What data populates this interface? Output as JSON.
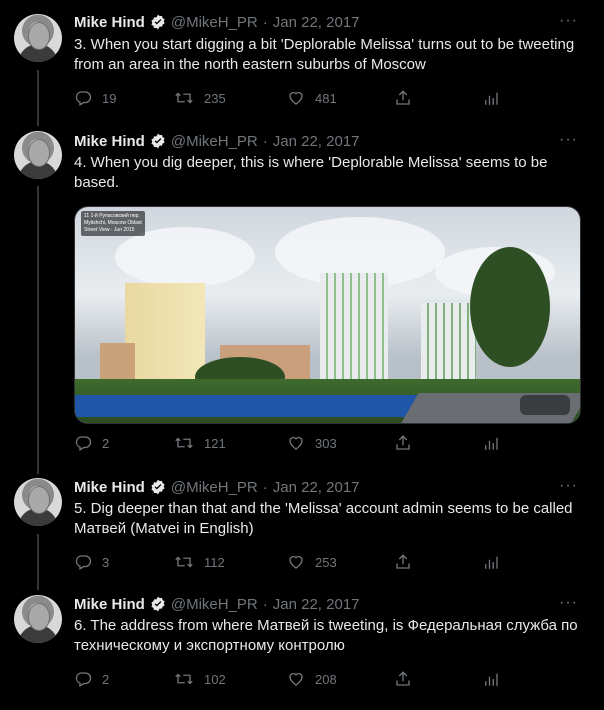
{
  "author": {
    "name": "Mike Hind",
    "handle": "@MikeH_PR",
    "separator": "·"
  },
  "more_glyph": "···",
  "tweets": [
    {
      "date": "Jan 22, 2017",
      "text": "3. When you start digging a bit 'Deplorable Melissa' turns out to be tweeting from an area in the north eastern suburbs of Moscow",
      "replies": "19",
      "retweets": "235",
      "likes": "481"
    },
    {
      "date": "Jan 22, 2017",
      "text": "4. When you dig deeper, this is where 'Deplorable Melissa' seems to be based.",
      "replies": "2",
      "retweets": "121",
      "likes": "303",
      "media": {
        "caption_lines": [
          "11 1-й Рупасовский пер.",
          "Mytishchi, Moscow Oblast",
          "Street View · Jun 2015"
        ]
      }
    },
    {
      "date": "Jan 22, 2017",
      "text": "5. Dig deeper than that and the 'Melissa' account admin seems to be called Матвей (Matvei in English)",
      "replies": "3",
      "retweets": "112",
      "likes": "253"
    },
    {
      "date": "Jan 22, 2017",
      "text": "6. The address from where Матвей is tweeting, is Федеральная служба по техническому и экспортному контролю",
      "replies": "2",
      "retweets": "102",
      "likes": "208"
    }
  ],
  "colors": {
    "background": "#000000",
    "text": "#e7e9ea",
    "muted": "#71767b",
    "verified": "#e7e9ea",
    "thread_line": "#333639"
  }
}
